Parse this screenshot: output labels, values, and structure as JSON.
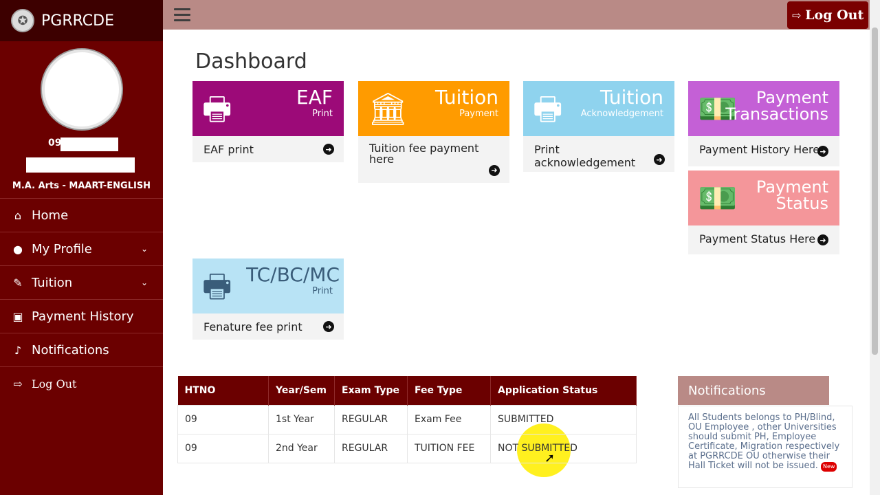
{
  "app": {
    "brand_name": "PGRRCDE",
    "logo_icon": "university-crest-icon"
  },
  "profile": {
    "htno_prefix": "09",
    "course": "M.A. Arts - MAART-ENGLISH"
  },
  "sidebar": {
    "items": [
      {
        "label": "Home",
        "icon": "home-icon",
        "has_chevron": false
      },
      {
        "label": "My Profile",
        "icon": "user-icon",
        "has_chevron": true
      },
      {
        "label": "Tuition",
        "icon": "edit-icon",
        "has_chevron": true
      },
      {
        "label": "Payment History",
        "icon": "money-icon",
        "has_chevron": false
      },
      {
        "label": "Notifications",
        "icon": "bell-icon",
        "has_chevron": false
      },
      {
        "label": "Log Out",
        "icon": "sign-out-icon",
        "has_chevron": false
      }
    ]
  },
  "topbar": {
    "logout_label": "Log Out"
  },
  "main": {
    "title": "Dashboard",
    "cards": [
      {
        "big": "EAF",
        "small": "Print",
        "footer": "EAF print",
        "icon": "printer-icon",
        "color": "#9c0a78"
      },
      {
        "big": "Tuition",
        "small": "Payment",
        "footer": "Tuition fee payment here",
        "icon": "bank-icon",
        "color": "#ff9b00"
      },
      {
        "big": "Tuition",
        "small": "Acknowledgement",
        "footer": "Print acknowledgement",
        "icon": "printer-icon",
        "color": "#8fd3ee"
      },
      {
        "big": "Payment Transactions",
        "small": "",
        "footer": "Payment History Here",
        "icon": "money-icon",
        "color": "#c460d6"
      },
      {
        "big": "Payment Status",
        "small": "",
        "footer": "Payment Status Here",
        "icon": "money-icon",
        "color": "#f4969a"
      },
      {
        "big": "TC/BC/MC",
        "small": "Print",
        "footer": "Fenature fee print",
        "icon": "printer-icon",
        "color": "#b8e3f5"
      }
    ]
  },
  "table": {
    "headers": [
      "HTNO",
      "Year/Sem",
      "Exam Type",
      "Fee Type",
      "Application Status"
    ],
    "rows": [
      [
        "09",
        "1st Year",
        "REGULAR",
        "Exam Fee",
        "SUBMITTED"
      ],
      [
        "09",
        "2nd Year",
        "REGULAR",
        "TUITION FEE",
        "NOT SUBMITTED"
      ]
    ]
  },
  "notifications": {
    "title": "Notifications",
    "text": "All Students belongs to PH/Blind, OU Employee , other Universities should submit PH, Employee Certificate, Migration respectively at PGRRCDE OU otherwise their Hall Ticket will not be issued.",
    "badge": "New"
  }
}
